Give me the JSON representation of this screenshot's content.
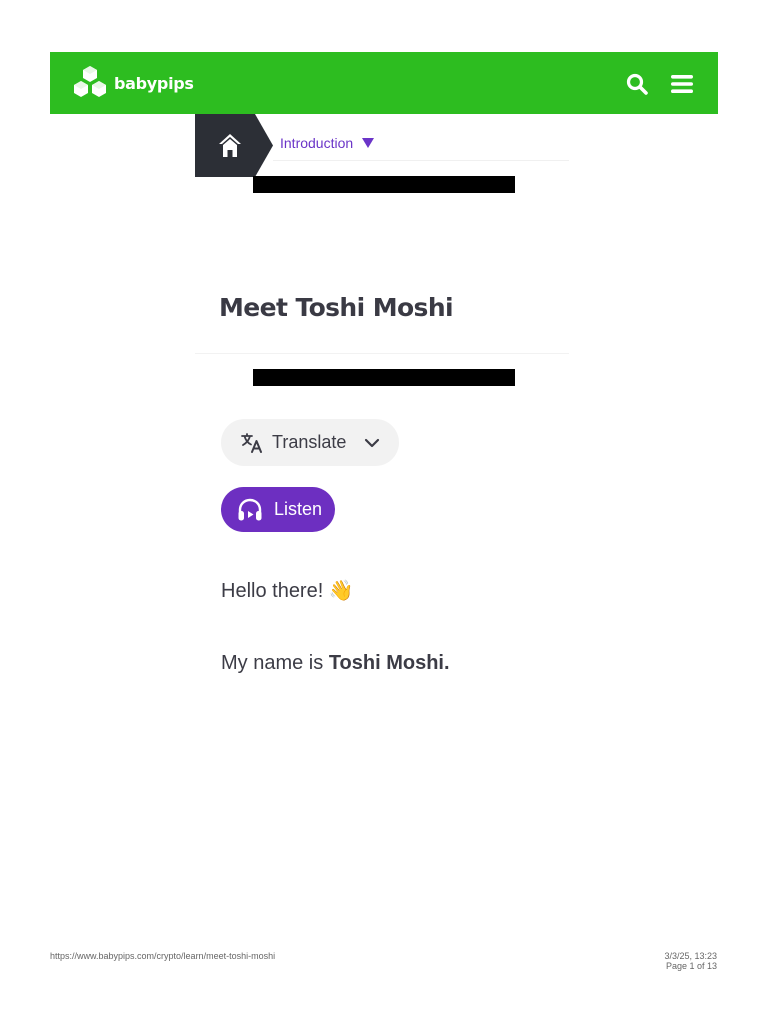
{
  "header": {
    "brand": "babypips",
    "brand_color": "#2dbd20",
    "icons": [
      "babypips-logo-icon",
      "search-icon",
      "hamburger-menu-icon"
    ]
  },
  "breadcrumb": {
    "home_icon": "home-icon",
    "section_label": "Introduction",
    "caret_icon": "caret-down-icon",
    "accent_color": "#6b35c8"
  },
  "article": {
    "title": "Meet Toshi Moshi",
    "translate_label": "Translate",
    "translate_icon": "translate-icon",
    "listen_label": "Listen",
    "listen_icon": "headphones-icon",
    "listen_color": "#6d2fc1",
    "greeting": "Hello there!",
    "greeting_emoji": "👋",
    "name_prefix": "My name is ",
    "name": "Toshi Moshi."
  },
  "footer": {
    "url": "https://www.babypips.com/crypto/learn/meet-toshi-moshi",
    "datetime": "3/3/25, 13:23",
    "page_info": "Page 1 of 13"
  }
}
